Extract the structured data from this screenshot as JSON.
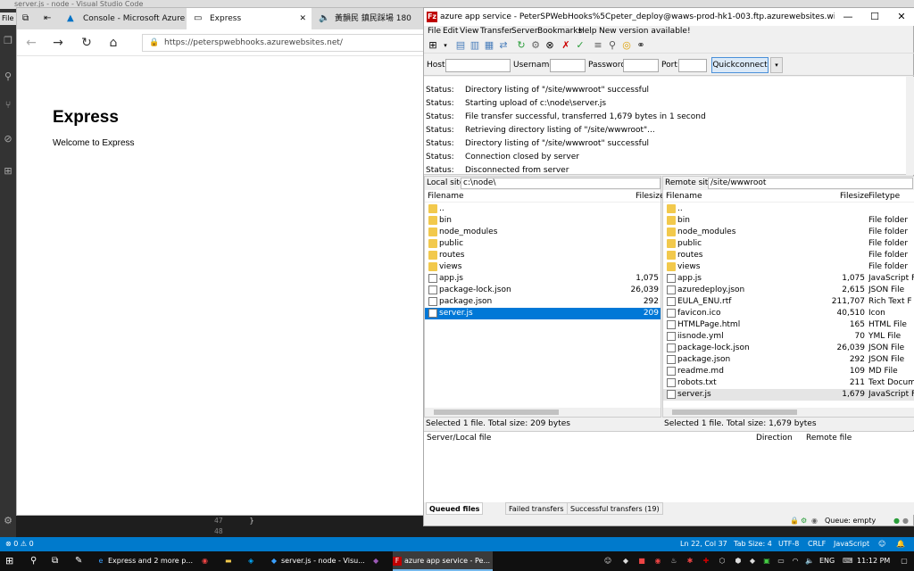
{
  "vscode": {
    "window_title": "server.js - node - Visual Studio Code",
    "menu_label": "File",
    "line_numbers": [
      "47",
      "48"
    ],
    "code_line": "}",
    "status": {
      "errors": "0",
      "warnings": "0",
      "position": "Ln 22, Col 37",
      "tab_size": "Tab Size: 4",
      "encoding": "UTF-8",
      "eol": "CRLF",
      "language": "JavaScript"
    }
  },
  "edge": {
    "tabs": [
      {
        "label": "Console - Microsoft Azure"
      },
      {
        "label": "Express"
      },
      {
        "label": "黃韻民 鎮民踩場 180"
      }
    ],
    "url": "https://peterspwebhooks.azurewebsites.net/",
    "page": {
      "heading": "Express",
      "text": "Welcome to Express"
    }
  },
  "filezilla": {
    "title": "azure app service - PeterSPWebHooks%5Cpeter_deploy@waws-prod-hk1-003.ftp.azurewebsites.windows.net - Fil...",
    "menu": [
      "File",
      "Edit",
      "View",
      "Transfer",
      "Server",
      "Bookmarks",
      "Help",
      "New version available!"
    ],
    "quickconnect": {
      "host_label": "Host:",
      "username_label": "Username:",
      "password_label": "Password:",
      "port_label": "Port:",
      "button": "Quickconnect"
    },
    "log": [
      {
        "k": "Status:",
        "v": "Directory listing of \"/site/wwwroot\" successful"
      },
      {
        "k": "Status:",
        "v": "Starting upload of c:\\node\\server.js"
      },
      {
        "k": "Status:",
        "v": "File transfer successful, transferred 1,679 bytes in 1 second"
      },
      {
        "k": "Status:",
        "v": "Retrieving directory listing of \"/site/wwwroot\"..."
      },
      {
        "k": "Status:",
        "v": "Directory listing of \"/site/wwwroot\" successful"
      },
      {
        "k": "Status:",
        "v": "Connection closed by server"
      },
      {
        "k": "Status:",
        "v": "Disconnected from server"
      }
    ],
    "local": {
      "site_label": "Local site:",
      "site_value": "c:\\node\\",
      "col_name": "Filename",
      "col_size": "Filesize",
      "files": [
        {
          "name": "..",
          "size": "",
          "folder": true
        },
        {
          "name": "bin",
          "size": "",
          "folder": true
        },
        {
          "name": "node_modules",
          "size": "",
          "folder": true
        },
        {
          "name": "public",
          "size": "",
          "folder": true
        },
        {
          "name": "routes",
          "size": "",
          "folder": true
        },
        {
          "name": "views",
          "size": "",
          "folder": true
        },
        {
          "name": "app.js",
          "size": "1,075",
          "folder": false
        },
        {
          "name": "package-lock.json",
          "size": "26,039",
          "folder": false
        },
        {
          "name": "package.json",
          "size": "292",
          "folder": false
        },
        {
          "name": "server.js",
          "size": "209",
          "folder": false
        }
      ],
      "status": "Selected 1 file. Total size: 209 bytes"
    },
    "remote": {
      "site_label": "Remote site:",
      "site_value": "/site/wwwroot",
      "col_name": "Filename",
      "col_size": "Filesize",
      "col_type": "Filetype",
      "files": [
        {
          "name": "..",
          "size": "",
          "type": "",
          "folder": true
        },
        {
          "name": "bin",
          "size": "",
          "type": "File folder",
          "folder": true
        },
        {
          "name": "node_modules",
          "size": "",
          "type": "File folder",
          "folder": true
        },
        {
          "name": "public",
          "size": "",
          "type": "File folder",
          "folder": true
        },
        {
          "name": "routes",
          "size": "",
          "type": "File folder",
          "folder": true
        },
        {
          "name": "views",
          "size": "",
          "type": "File folder",
          "folder": true
        },
        {
          "name": "app.js",
          "size": "1,075",
          "type": "JavaScript F",
          "folder": false
        },
        {
          "name": "azuredeploy.json",
          "size": "2,615",
          "type": "JSON File",
          "folder": false
        },
        {
          "name": "EULA_ENU.rtf",
          "size": "211,707",
          "type": "Rich Text F",
          "folder": false
        },
        {
          "name": "favicon.ico",
          "size": "40,510",
          "type": "Icon",
          "folder": false
        },
        {
          "name": "HTMLPage.html",
          "size": "165",
          "type": "HTML File",
          "folder": false
        },
        {
          "name": "iisnode.yml",
          "size": "70",
          "type": "YML File",
          "folder": false
        },
        {
          "name": "package-lock.json",
          "size": "26,039",
          "type": "JSON File",
          "folder": false
        },
        {
          "name": "package.json",
          "size": "292",
          "type": "JSON File",
          "folder": false
        },
        {
          "name": "readme.md",
          "size": "109",
          "type": "MD File",
          "folder": false
        },
        {
          "name": "robots.txt",
          "size": "211",
          "type": "Text Docum",
          "folder": false
        },
        {
          "name": "server.js",
          "size": "1,679",
          "type": "JavaScript F",
          "folder": false
        }
      ],
      "status": "Selected 1 file. Total size: 1,679 bytes"
    },
    "queue": {
      "col_server": "Server/Local file",
      "col_direction": "Direction",
      "col_remote": "Remote file",
      "tabs": [
        "Queued files",
        "Failed transfers",
        "Successful transfers (19)"
      ],
      "status": "Queue: empty"
    }
  },
  "taskbar": {
    "items": [
      {
        "label": "Express and 2 more p..."
      },
      {
        "label": "server.js - node - Visu..."
      },
      {
        "label": "azure app service - Pe..."
      }
    ],
    "lang": "ENG",
    "time": "11:12 PM"
  },
  "colors": {
    "vscode_status": "#007acc",
    "selection": "#0078d7",
    "filezilla_logo": "#bf0000",
    "folder": "#f2c94c"
  }
}
